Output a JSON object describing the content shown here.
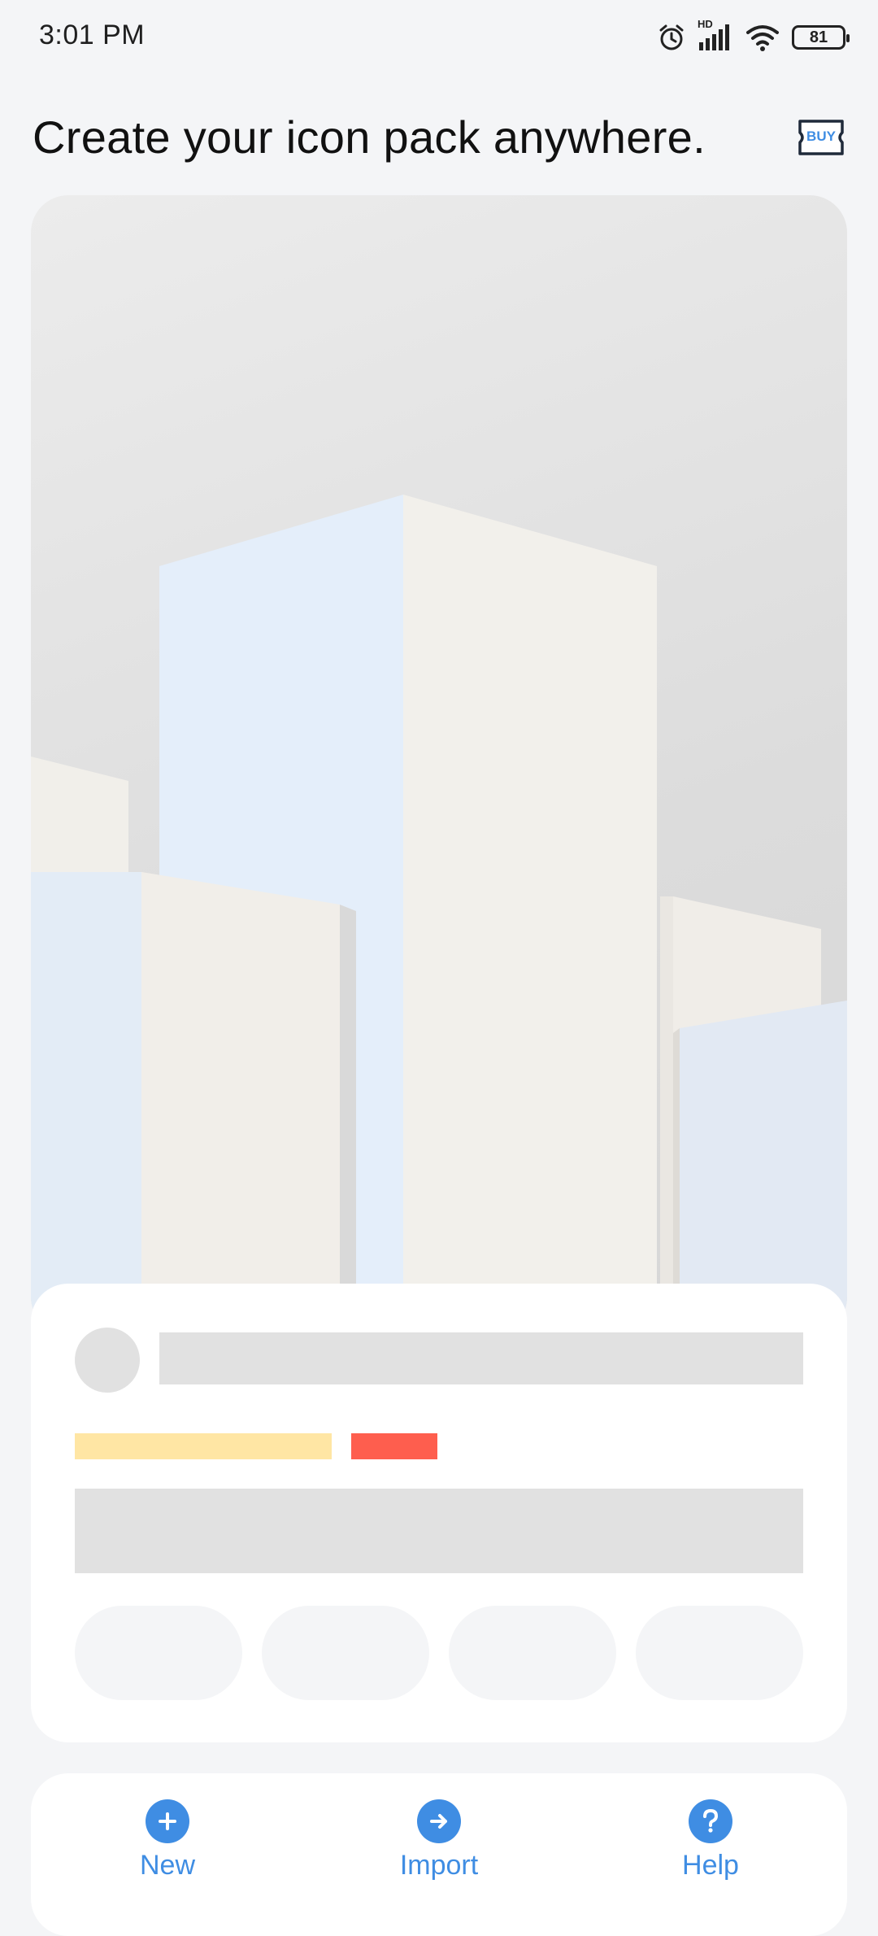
{
  "status_bar": {
    "time": "3:01 PM",
    "network_label": "HD",
    "battery_level": "81",
    "icons": [
      "alarm-icon",
      "signal-icon",
      "wifi-icon",
      "battery-icon"
    ]
  },
  "header": {
    "title": "Create your icon pack anywhere.",
    "buy_label": "BUY"
  },
  "bottom_nav": {
    "items": [
      {
        "label": "New",
        "icon": "plus-icon"
      },
      {
        "label": "Import",
        "icon": "arrow-right-icon"
      },
      {
        "label": "Help",
        "icon": "question-icon"
      }
    ]
  },
  "colors": {
    "accent": "#3f8de3",
    "background": "#f4f5f7",
    "card": "#ffffff",
    "skeleton": "#e1e1e1",
    "tag_yellow": "#ffe6a4",
    "tag_red": "#fe5e4e"
  }
}
